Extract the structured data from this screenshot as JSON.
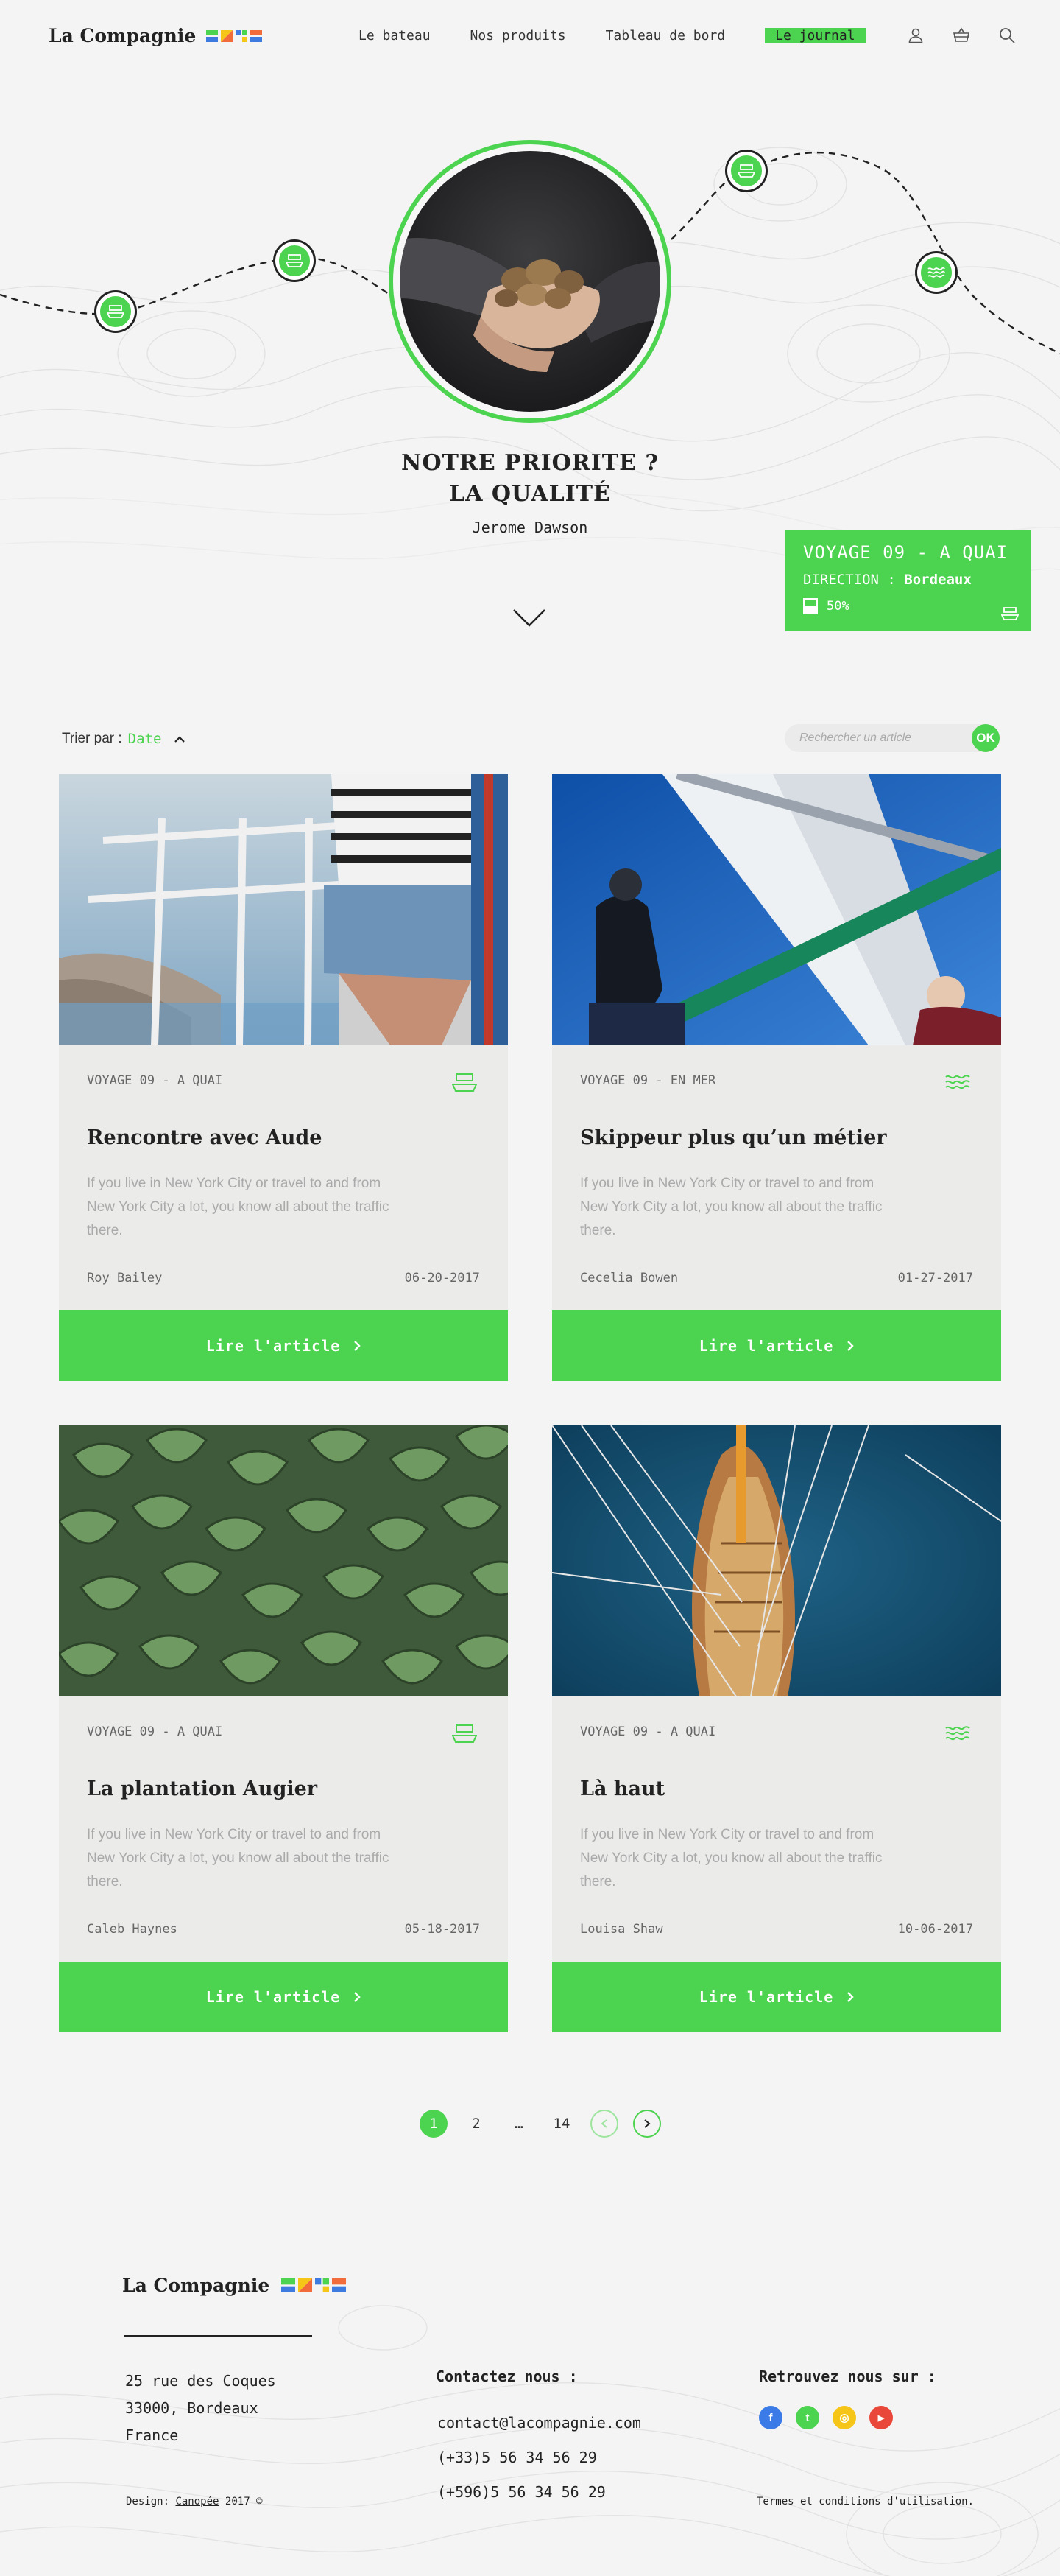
{
  "brand": {
    "name": "La Compagnie",
    "marks": [
      "#4cd34f",
      "#f26b3a",
      "#3d7be0",
      "#f5c518"
    ]
  },
  "nav": {
    "links": [
      {
        "label": "Le bateau"
      },
      {
        "label": "Nos produits"
      },
      {
        "label": "Tableau de bord"
      },
      {
        "label": "Le journal",
        "active": true
      }
    ],
    "icons": [
      "user-icon",
      "basket-icon",
      "search-icon"
    ]
  },
  "hero": {
    "title_line1": "NOTRE PRIORITE ?",
    "title_line2": "LA QUALITÉ",
    "author": "Jerome Dawson",
    "route_icons": [
      "ship-icon",
      "ship-icon",
      "ship-icon",
      "waves-icon"
    ],
    "voyage": {
      "title": "VOYAGE 09 - A QUAI",
      "direction_label": "DIRECTION :",
      "direction_value": "Bordeaux",
      "progress": "50%",
      "progress_value": 0.5
    }
  },
  "filter": {
    "sort_label": "Trier par :",
    "sort_value": "Date",
    "search_placeholder": "Rechercher un article",
    "search_button": "OK"
  },
  "articles": [
    {
      "tag": "VOYAGE 09 - A QUAI",
      "icon": "ship-icon",
      "title": "Rencontre avec Aude",
      "excerpt": "If you live in New York City or travel to and from New York City a lot, you know all about the traffic there.",
      "author": "Roy Bailey",
      "date": "06-20-2017",
      "button": "Lire l'article"
    },
    {
      "tag": "VOYAGE 09 - EN MER",
      "icon": "waves-icon",
      "title": "Skippeur plus qu’un métier",
      "excerpt": "If you live in New York City or travel to and from New York City a lot, you know all about the traffic there.",
      "author": "Cecelia Bowen",
      "date": "01-27-2017",
      "button": "Lire l'article"
    },
    {
      "tag": "VOYAGE 09 - A QUAI",
      "icon": "ship-icon",
      "title": "La plantation Augier",
      "excerpt": "If you live in New York City or travel to and from New York City a lot, you know all about the traffic there.",
      "author": "Caleb Haynes",
      "date": "05-18-2017",
      "button": "Lire l'article"
    },
    {
      "tag": "VOYAGE 09 - A QUAI",
      "icon": "waves-icon",
      "title": "Là haut",
      "excerpt": "If you live in New York City or travel to and from New York City a lot, you know all about the traffic there.",
      "author": "Louisa Shaw",
      "date": "10-06-2017",
      "button": "Lire l'article"
    }
  ],
  "pagination": {
    "pages": [
      "1",
      "2",
      "…",
      "14"
    ],
    "current": "1"
  },
  "footer": {
    "address": [
      "25 rue des Coques",
      "33000, Bordeaux",
      "France"
    ],
    "contact_title": "Contactez nous :",
    "email": "contact@lacompagnie.com",
    "phone1": "(+33)5 56 34 56 29",
    "phone2": "(+596)5 56 34 56 29",
    "social_title": "Retrouvez nous sur :",
    "social": [
      {
        "name": "facebook",
        "glyph": "f",
        "color": "#3b7be8"
      },
      {
        "name": "twitter",
        "glyph": "t",
        "color": "#4cd34f"
      },
      {
        "name": "instagram",
        "glyph": "◎",
        "color": "#f5c518"
      },
      {
        "name": "youtube",
        "glyph": "▶",
        "color": "#e9473a"
      }
    ],
    "credit_prefix": "Design:",
    "credit_link": "Canopée",
    "credit_suffix": "2017 ©",
    "terms": "Termes et conditions d'utilisation."
  }
}
